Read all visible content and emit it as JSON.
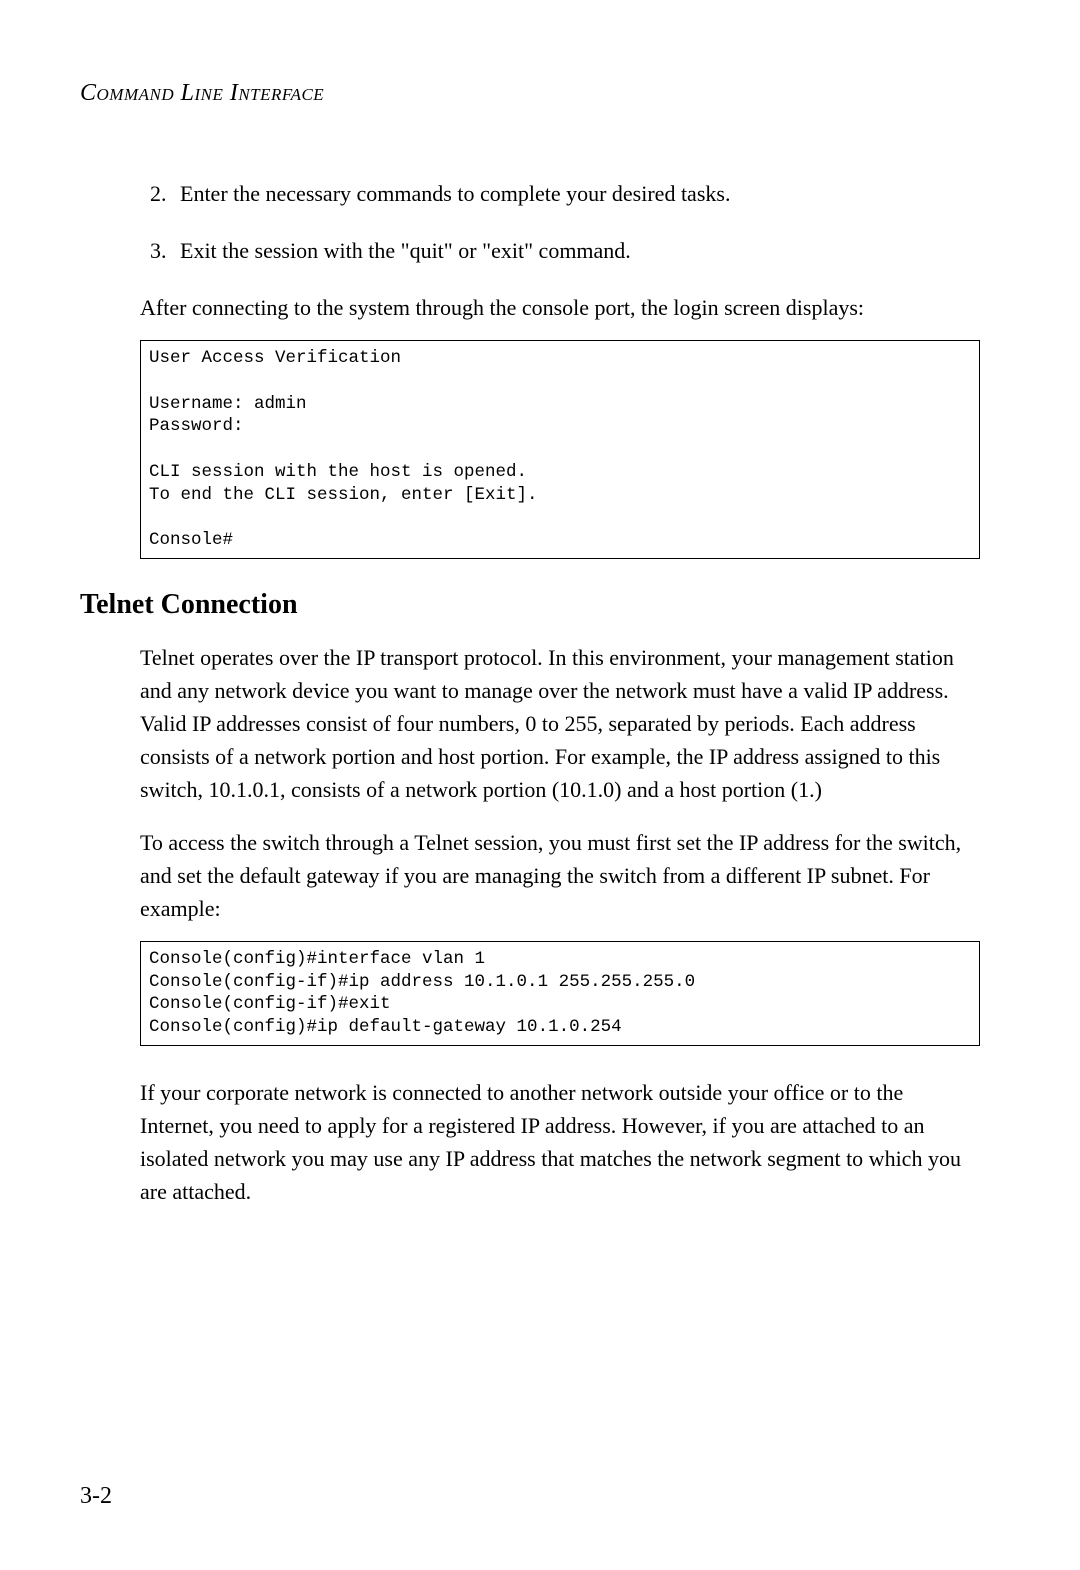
{
  "header": {
    "title": "Command Line Interface"
  },
  "list": [
    {
      "number": "2.",
      "text": "Enter the necessary commands to complete your desired tasks."
    },
    {
      "number": "3.",
      "text": "Exit the session with the \"quit\" or \"exit\" command."
    }
  ],
  "para1": "After connecting to the system through the console port, the login screen displays:",
  "code1": "User Access Verification\n\nUsername: admin\nPassword:\n\nCLI session with the host is opened.\nTo end the CLI session, enter [Exit].\n\nConsole#",
  "section_heading": "Telnet Connection",
  "para2": "Telnet operates over the IP transport protocol. In this environment, your management station and any network device you want to manage over the network must have a valid IP address. Valid IP addresses consist of four numbers, 0 to 255, separated by periods. Each address consists of a network portion and host portion. For example, the IP address assigned to this switch, 10.1.0.1, consists of a network portion (10.1.0) and a host portion (1.)",
  "para3": "To access the switch through a Telnet session, you must first set the IP address for the switch, and set the default gateway if you are managing the switch from a different IP subnet. For example:",
  "code2": "Console(config)#interface vlan 1\nConsole(config-if)#ip address 10.1.0.1 255.255.255.0\nConsole(config-if)#exit\nConsole(config)#ip default-gateway 10.1.0.254",
  "para4": "If your corporate network is connected to another network outside your office or to the Internet, you need to apply for a registered IP address. However, if you are attached to an isolated network you may use any IP address that matches the network segment to which you are attached.",
  "page_number": "3-2"
}
